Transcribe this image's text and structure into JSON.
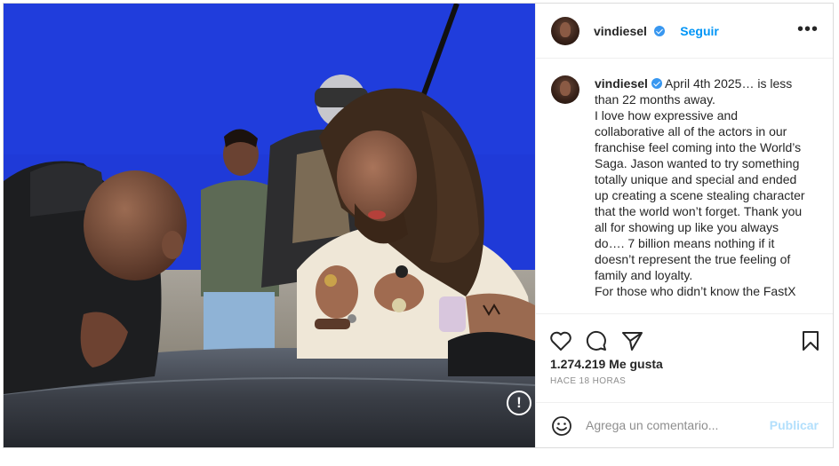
{
  "post": {
    "username": "vindiesel",
    "follow_label": "Seguir",
    "caption_lines": [
      "April 4th 2025… is less than 22 months away.",
      "I love how expressive and collaborative all of the actors in our franchise feel coming into the World’s Saga. Jason wanted to try something totally unique and special and ended up creating a scene stealing character that the world won’t forget. Thank you all for showing up like you always do…. 7 billion means nothing if it doesn’t represent the true feeling of family and loyalty.",
      "For those who didn’t know the FastX"
    ],
    "likes": "1.274.219 Me gusta",
    "time_ago": "HACE 18 HORAS",
    "comment_placeholder": "Agrega un comentario...",
    "publish_label": "Publicar",
    "sensitive_marker": "!"
  },
  "icons": [
    "more-options-icon",
    "like-heart-icon",
    "comment-icon",
    "share-icon",
    "save-bookmark-icon",
    "emoji-icon",
    "verified-badge-icon",
    "alert-icon"
  ],
  "colors": {
    "accent": "#0095f6",
    "verified": "#3897f0",
    "backdrop": "#1f3ad8",
    "muted": "#8e8e8e"
  }
}
